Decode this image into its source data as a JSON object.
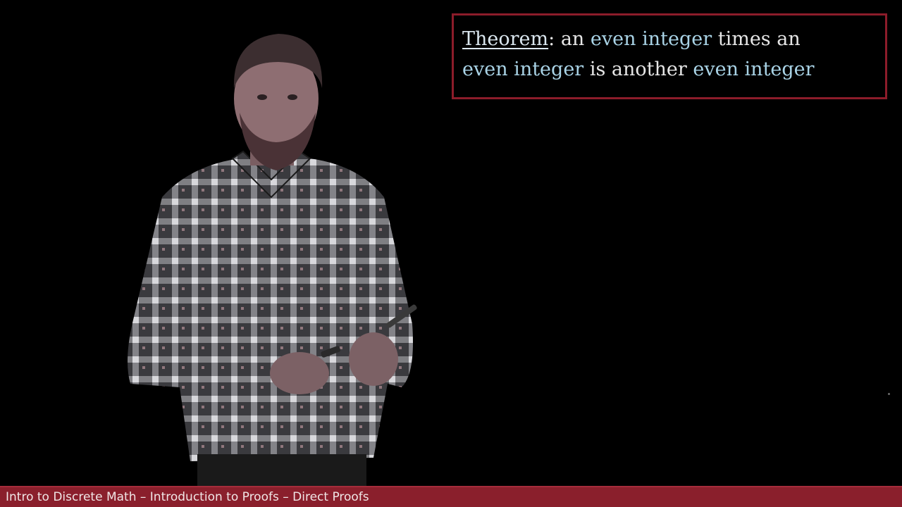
{
  "theorem": {
    "label": "Theorem",
    "colon": ":",
    "line1": [
      {
        "text": "an",
        "style": "plain"
      },
      {
        "text": "even integer",
        "style": "even"
      },
      {
        "text": "times an",
        "style": "plain"
      }
    ],
    "line2": [
      {
        "text": "even integer",
        "style": "even"
      },
      {
        "text": "is another",
        "style": "plain"
      },
      {
        "text": "even integer",
        "style": "even"
      }
    ]
  },
  "footer": {
    "text": "Intro to Discrete Math – Introduction to Proofs – Direct Proofs"
  },
  "colors": {
    "accent": "#8a1f2c",
    "even_text": "#a9d3e6",
    "plain_text": "#e6e6e6"
  }
}
